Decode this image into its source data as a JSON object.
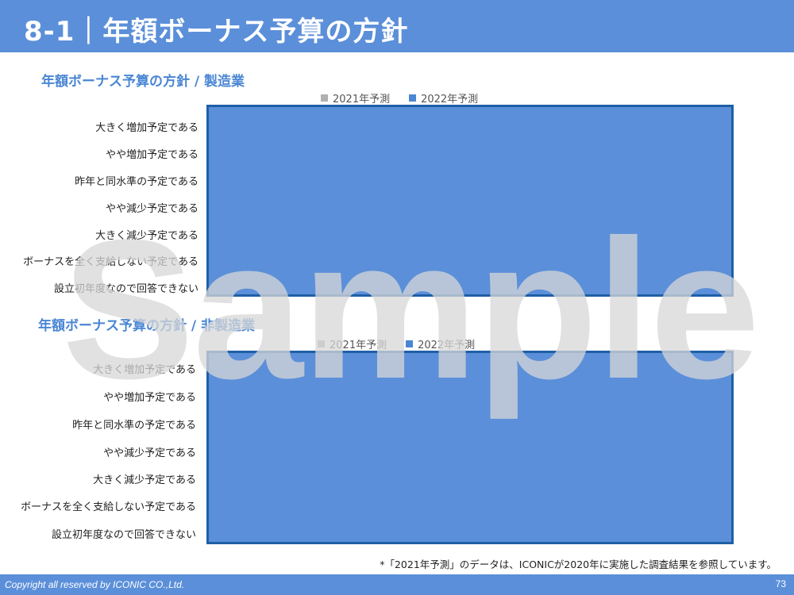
{
  "header": {
    "title": "8-1｜年額ボーナス予算の方針"
  },
  "colors": {
    "accent": "#5b8fd9",
    "border": "#1f5fa6",
    "series_2021": "#b0b0b0",
    "series_2022": "#5b8fd9"
  },
  "chart_data": [
    {
      "type": "bar",
      "title": "年額ボーナス予算の方針 / 製造業",
      "categories": [
        "大きく増加予定である",
        "やや増加予定である",
        "昨年と同水準の予定である",
        "やや減少予定である",
        "大きく減少予定である",
        "ボーナスを全く支給しない予定である",
        "設立初年度なので回答できない"
      ],
      "series": [
        {
          "name": "2021年予測",
          "values": []
        },
        {
          "name": "2022年予測",
          "values": []
        }
      ],
      "legend_position": "top"
    },
    {
      "type": "bar",
      "title": "年額ボーナス予算の方針 / 非製造業",
      "categories": [
        "大きく増加予定である",
        "やや増加予定である",
        "昨年と同水準の予定である",
        "やや減少予定である",
        "大きく減少予定である",
        "ボーナスを全く支給しない予定である",
        "設立初年度なので回答できない"
      ],
      "series": [
        {
          "name": "2021年予測",
          "values": []
        },
        {
          "name": "2022年予測",
          "values": []
        }
      ],
      "legend_position": "top"
    }
  ],
  "watermark": "Sample",
  "footnote": "*「2021年予測」のデータは、ICONICが2020年に実施した調査結果を参照しています。",
  "footer": {
    "copyright": "Copyright all reserved by ICONIC CO.,Ltd.",
    "page_number": "73"
  }
}
